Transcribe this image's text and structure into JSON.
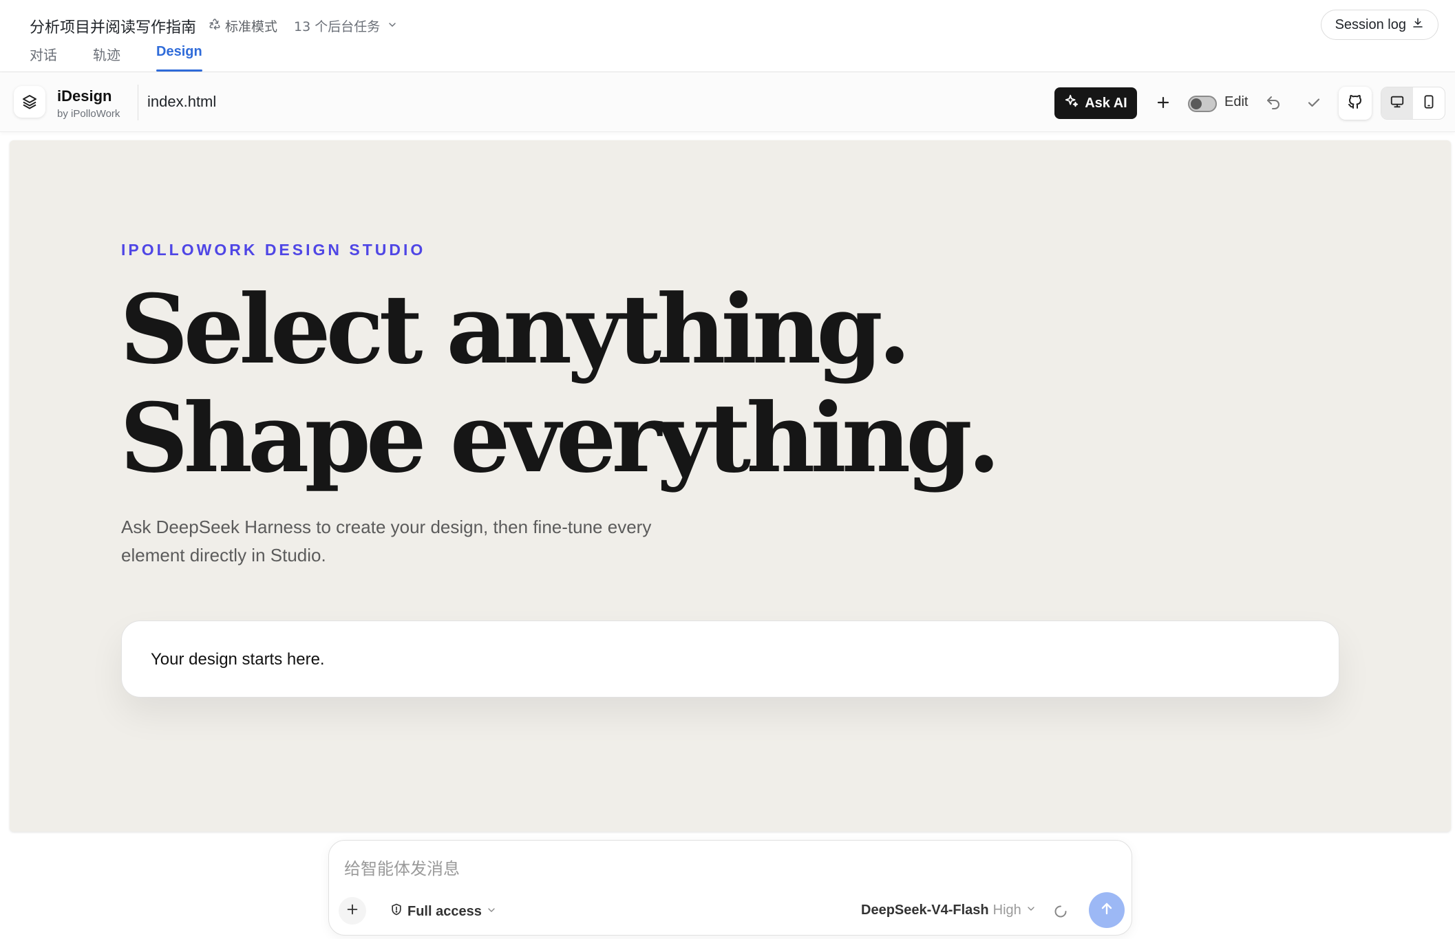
{
  "header": {
    "title": "分析项目并阅读写作指南",
    "mode_label": "标准模式",
    "tasks_label": "13 个后台任务",
    "session_log_label": "Session log",
    "tabs": [
      {
        "label": "对话",
        "active": false
      },
      {
        "label": "轨迹",
        "active": false
      },
      {
        "label": "Design",
        "active": true
      }
    ]
  },
  "toolbar": {
    "brand_name": "iDesign",
    "brand_by": "by iPolloWork",
    "filename": "index.html",
    "ask_ai_label": "Ask AI",
    "edit_label": "Edit",
    "edit_enabled": false,
    "device_selected": "desktop"
  },
  "canvas": {
    "kicker": "IPOLLOWORK DESIGN STUDIO",
    "headline_line1": "Select anything.",
    "headline_line2": "Shape everything.",
    "subline": "Ask DeepSeek Harness to create your design, then fine-tune every element directly in Studio.",
    "card_text": "Your design starts here."
  },
  "composer": {
    "placeholder": "给智能体发消息",
    "value": "",
    "access_label": "Full access",
    "model_name": "DeepSeek-V4-Flash",
    "model_effort": "High"
  },
  "colors": {
    "accent_blue": "#2f6bd9",
    "kicker_indigo": "#4f46e5",
    "canvas_bg": "#f0eee9",
    "send_button": "#9cb8f5",
    "ask_ai_bg": "#161616"
  }
}
